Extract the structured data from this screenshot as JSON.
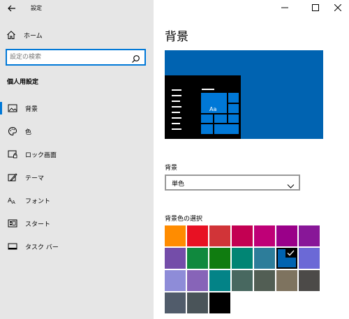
{
  "window": {
    "title": "設定",
    "buttons": [
      "minimize",
      "maximize",
      "close"
    ]
  },
  "sidebar": {
    "home_label": "ホーム",
    "search_placeholder": "設定の検索",
    "section_heading": "個人用設定",
    "items": [
      {
        "label": "背景",
        "icon": "image-icon",
        "selected": true
      },
      {
        "label": "色",
        "icon": "palette-icon",
        "selected": false
      },
      {
        "label": "ロック画面",
        "icon": "lock-screen-icon",
        "selected": false
      },
      {
        "label": "テーマ",
        "icon": "theme-icon",
        "selected": false
      },
      {
        "label": "フォント",
        "icon": "font-icon",
        "selected": false
      },
      {
        "label": "スタート",
        "icon": "start-icon",
        "selected": false
      },
      {
        "label": "タスク バー",
        "icon": "taskbar-icon",
        "selected": false
      }
    ]
  },
  "main": {
    "title": "背景",
    "preview": {
      "tile_text": "Aa",
      "background_color": "#0063b1"
    },
    "background_label": "背景",
    "background_value": "単色",
    "color_choice_label": "背景色の選択",
    "swatches": [
      [
        "#ff8c00",
        "#e81123",
        "#d13438",
        "#c30052",
        "#bf0077",
        "#9a0089",
        "#881798"
      ],
      [
        "#744da9",
        "#10893e",
        "#107c10",
        "#018574",
        "#2d7d9a",
        "#0063b1",
        "#6b69d6"
      ],
      [
        "#8e8cd8",
        "#8764b8",
        "#038387",
        "#486860",
        "#525e54",
        "#7e735f",
        "#4c4a48"
      ],
      [
        "#515c6b",
        "#4a5459",
        "#000000"
      ]
    ],
    "selected_swatch": "#0063b1"
  },
  "colors": {
    "accent": "#0078d7",
    "sidebar_bg": "#e6e6e6"
  }
}
